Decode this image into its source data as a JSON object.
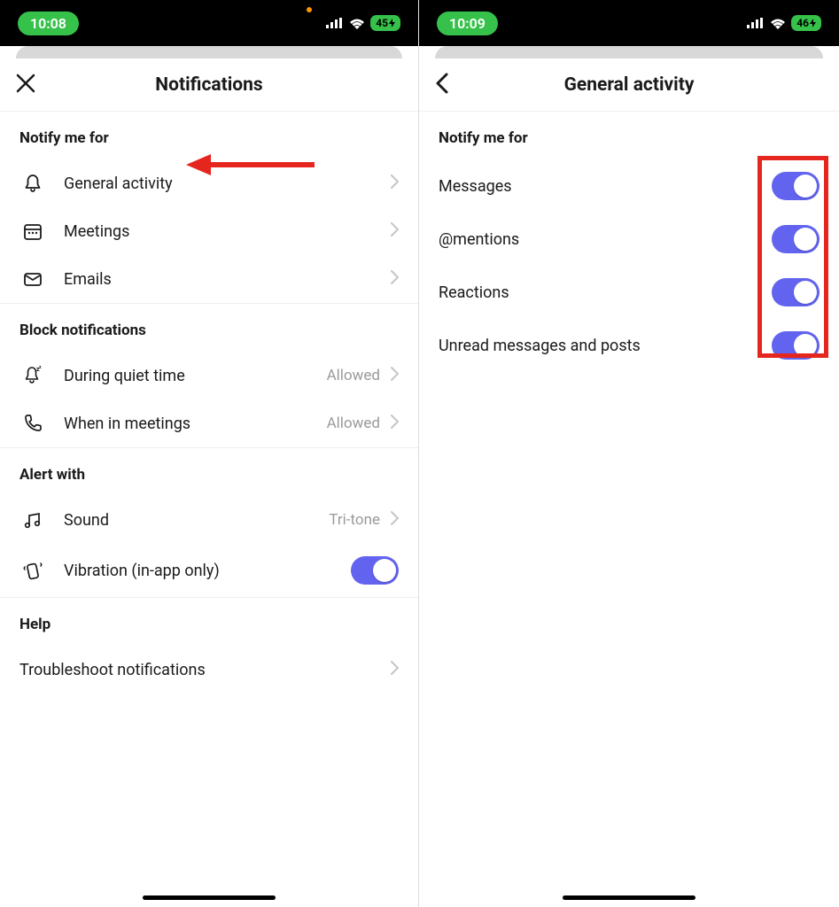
{
  "left": {
    "statusbar": {
      "time": "10:08",
      "battery": "45"
    },
    "nav": {
      "title": "Notifications"
    },
    "sections": {
      "notify": {
        "header": "Notify me for",
        "items": [
          {
            "label": "General activity"
          },
          {
            "label": "Meetings"
          },
          {
            "label": "Emails"
          }
        ]
      },
      "block": {
        "header": "Block notifications",
        "items": [
          {
            "label": "During quiet time",
            "value": "Allowed"
          },
          {
            "label": "When in meetings",
            "value": "Allowed"
          }
        ]
      },
      "alert": {
        "header": "Alert with",
        "items": [
          {
            "label": "Sound",
            "value": "Tri-tone"
          },
          {
            "label": "Vibration (in-app only)"
          }
        ]
      },
      "help": {
        "header": "Help",
        "items": [
          {
            "label": "Troubleshoot notifications"
          }
        ]
      }
    }
  },
  "right": {
    "statusbar": {
      "time": "10:09",
      "battery": "46"
    },
    "nav": {
      "title": "General activity"
    },
    "sections": {
      "notify": {
        "header": "Notify me for",
        "items": [
          {
            "label": "Messages"
          },
          {
            "label": "@mentions"
          },
          {
            "label": "Reactions"
          },
          {
            "label": "Unread messages and posts"
          }
        ]
      }
    }
  }
}
